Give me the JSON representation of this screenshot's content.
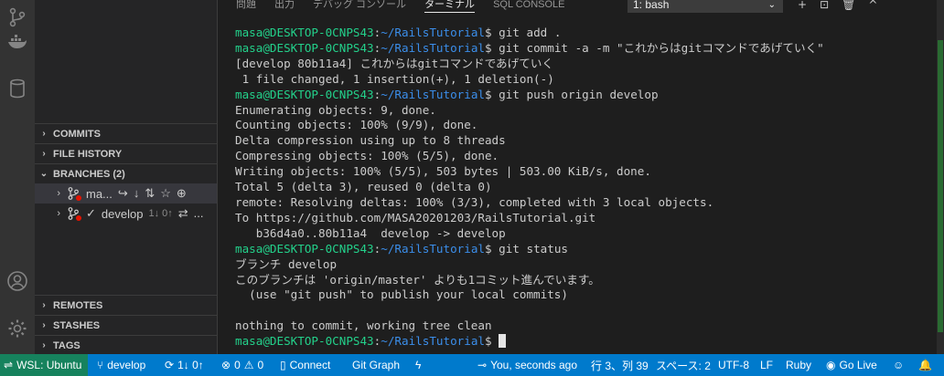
{
  "sidebar": {
    "sections": [
      {
        "label": "COMMITS",
        "chevron": "›"
      },
      {
        "label": "FILE HISTORY",
        "chevron": "›"
      },
      {
        "label": "BRANCHES (2)",
        "chevron": "⌄"
      },
      {
        "label": "REMOTES",
        "chevron": "›"
      },
      {
        "label": "STASHES",
        "chevron": "›"
      },
      {
        "label": "TAGS",
        "chevron": "›"
      }
    ],
    "branches": [
      {
        "name": "ma...",
        "check": "",
        "counts": "",
        "actions": [
          "↪",
          "↓",
          "⇅",
          "☆",
          "⊕"
        ]
      },
      {
        "name": "develop",
        "check": "✓",
        "counts": "1↓ 0↑",
        "actions": [
          "⇄",
          "..."
        ]
      }
    ]
  },
  "panel": {
    "tabs": [
      "問題",
      "出力",
      "デバッグ コンソール",
      "ターミナル",
      "SQL CONSOLE"
    ],
    "active_tab": "ターミナル",
    "terminal_select": "1: bash",
    "actions": [
      "+",
      "⊡",
      "🗑",
      "^"
    ]
  },
  "terminal": {
    "user": "masa@DESKTOP-0CNPS43",
    "path": "~/RailsTutorial",
    "lines": [
      {
        "prompt": true,
        "cmd": " git add ."
      },
      {
        "prompt": true,
        "cmd": " git commit -a -m \"これからはgitコマンドであげていく\""
      },
      {
        "text": "[develop 80b11a4] これからはgitコマンドであげていく"
      },
      {
        "text": " 1 file changed, 1 insertion(+), 1 deletion(-)"
      },
      {
        "prompt": true,
        "cmd": " git push origin develop"
      },
      {
        "text": "Enumerating objects: 9, done."
      },
      {
        "text": "Counting objects: 100% (9/9), done."
      },
      {
        "text": "Delta compression using up to 8 threads"
      },
      {
        "text": "Compressing objects: 100% (5/5), done."
      },
      {
        "text": "Writing objects: 100% (5/5), 503 bytes | 503.00 KiB/s, done."
      },
      {
        "text": "Total 5 (delta 3), reused 0 (delta 0)"
      },
      {
        "text": "remote: Resolving deltas: 100% (3/3), completed with 3 local objects."
      },
      {
        "text": "To https://github.com/MASA20201203/RailsTutorial.git"
      },
      {
        "text": "   b36d4a0..80b11a4  develop -> develop"
      },
      {
        "prompt": true,
        "cmd": " git status"
      },
      {
        "text": "ブランチ develop"
      },
      {
        "text": "このブランチは 'origin/master' よりも1コミット進んでいます。"
      },
      {
        "text": "  (use \"git push\" to publish your local commits)"
      },
      {
        "text": ""
      },
      {
        "text": "nothing to commit, working tree clean"
      },
      {
        "prompt": true,
        "cmd": " ",
        "cursor": true
      }
    ]
  },
  "statusbar": {
    "remote": "WSL: Ubuntu",
    "branch": "develop",
    "sync": "1↓ 0↑",
    "problems": "0",
    "warnings": "0",
    "connect": "Connect",
    "git_graph": "Git Graph",
    "blame": "You, seconds ago",
    "position": "行 3、列 39",
    "spaces": "スペース: 2",
    "encoding": "UTF-8",
    "eol": "LF",
    "language": "Ruby",
    "golive": "Go Live"
  },
  "colors": {
    "statusbar": "#007acc",
    "remote": "#16825d",
    "prompt_user": "#23d18b",
    "prompt_path": "#3b8eea"
  }
}
